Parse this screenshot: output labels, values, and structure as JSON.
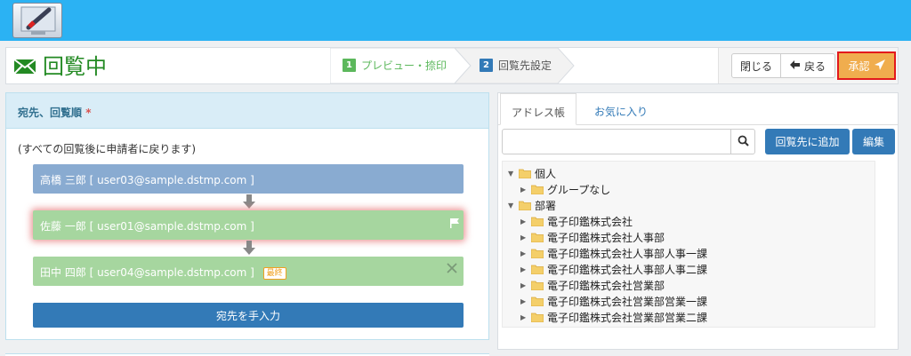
{
  "app": {
    "logo_icon": "pen-monitor-logo",
    "accent": "#2bb2f3"
  },
  "header": {
    "title": "回覧中",
    "title_icon": "envelope-icon",
    "steps": [
      {
        "number": "1",
        "label": "プレビュー・捺印",
        "color": "#5cb85c"
      },
      {
        "number": "2",
        "label": "回覧先設定",
        "color": "#337ab7"
      }
    ],
    "actions": {
      "close": "閉じる",
      "back": "戻る",
      "approve": "承認"
    }
  },
  "routing": {
    "heading": "宛先、回覧順",
    "required_mark": "*",
    "note": "(すべての回覧後に申請者に戻ります)",
    "recipients": [
      {
        "text": "高橋 三郎 [ user03@sample.dstmp.com ]",
        "color": "#89abd1"
      },
      {
        "text": "佐藤 一郎 [ user01@sample.dstmp.com ]",
        "color": "#a6d69f",
        "current": true
      },
      {
        "text": "田中 四郎 [ user04@sample.dstmp.com ]",
        "color": "#a6d69f",
        "badge": "最終"
      }
    ],
    "manual_button": "宛先を手入力"
  },
  "address_book": {
    "tabs": [
      "アドレス帳",
      "お気に入り"
    ],
    "active_tab": "アドレス帳",
    "search": {
      "value": "",
      "placeholder": ""
    },
    "add_button": "回覧先に追加",
    "edit_button": "編集",
    "tree": [
      {
        "label": "個人",
        "expanded": true,
        "level": 0
      },
      {
        "label": "グループなし",
        "expanded": false,
        "level": 1
      },
      {
        "label": "部署",
        "expanded": true,
        "level": 0
      },
      {
        "label": "電子印鑑株式会社",
        "expanded": false,
        "level": 1
      },
      {
        "label": "電子印鑑株式会社人事部",
        "expanded": false,
        "level": 1
      },
      {
        "label": "電子印鑑株式会社人事部人事一課",
        "expanded": false,
        "level": 1
      },
      {
        "label": "電子印鑑株式会社人事部人事二課",
        "expanded": false,
        "level": 1
      },
      {
        "label": "電子印鑑株式会社営業部",
        "expanded": false,
        "level": 1
      },
      {
        "label": "電子印鑑株式会社営業部営業一課",
        "expanded": false,
        "level": 1
      },
      {
        "label": "電子印鑑株式会社営業部営業二課",
        "expanded": false,
        "level": 1
      }
    ]
  }
}
